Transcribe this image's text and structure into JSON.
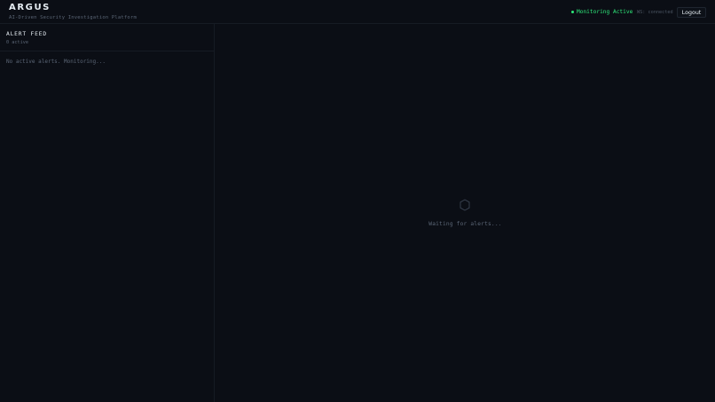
{
  "header": {
    "title": "ARGUS",
    "subtitle": "AI-Driven Security Investigation Platform",
    "status_label": "Monitoring Active",
    "ws_status": "WS: connected",
    "logout_label": "Logout"
  },
  "sidebar": {
    "title": "ALERT FEED",
    "count_label": "0 active",
    "empty_message": "No active alerts. Monitoring..."
  },
  "main": {
    "placeholder_icon": "hexagon-icon",
    "waiting_message": "Waiting for alerts..."
  },
  "colors": {
    "background": "#0b0e15",
    "accent_green": "#2ee87a",
    "muted_text": "#5b6676",
    "border": "#161b24"
  }
}
